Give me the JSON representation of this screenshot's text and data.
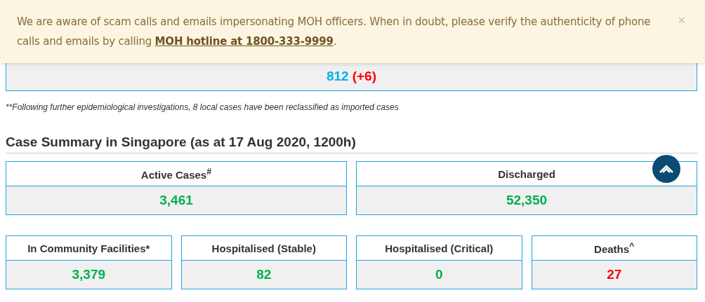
{
  "alert": {
    "text": "We are aware of scam calls and emails impersonating MOH officers. When in doubt, please verify the authenticity of phone calls and emails by calling ",
    "link": "MOH hotline at 1800-333-9999",
    "tail": ".",
    "close": "×"
  },
  "top_card": {
    "parts": [
      {
        "text": "812",
        "color": "#00b0f0"
      },
      {
        "text": "(+6)",
        "color": "#ff0000"
      }
    ]
  },
  "footnote": "**Following further epidemiological investigations, 8 local cases have been reclassified as imported cases",
  "heading": "Case Summary in Singapore (as at 17 Aug 2020, 1200h)",
  "rows": [
    [
      {
        "label": "Active Cases$^{#}$",
        "value": "3,461",
        "color": "#00b050"
      },
      {
        "label": "Discharged",
        "value": "52,350",
        "color": "#00b050"
      }
    ],
    [
      {
        "label": "In Community Facilities*",
        "value": "3,379",
        "color": "#00b050"
      },
      {
        "label": "Hospitalised (Stable)",
        "value": "82",
        "color": "#00b050"
      },
      {
        "label": "Hospitalised (Critical)",
        "value": "0",
        "color": "#00b050"
      },
      {
        "label": "Deaths$^{^}$",
        "value": "27",
        "color": "#ff0000"
      }
    ]
  ]
}
